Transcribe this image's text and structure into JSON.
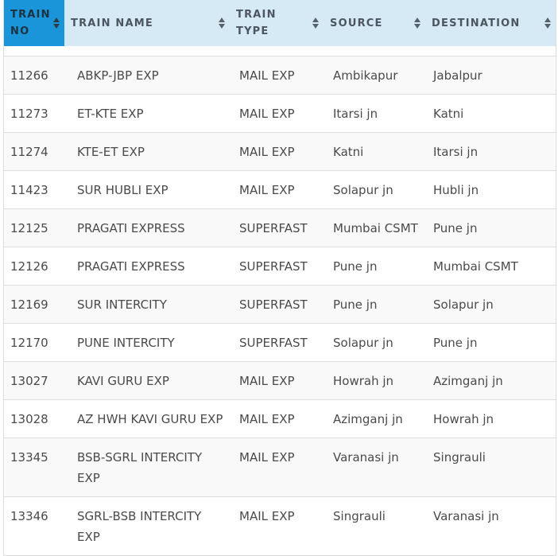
{
  "header": {
    "train_no": "TRAIN NO",
    "train_name": "TRAIN NAME",
    "train_type": "TRAIN TYPE",
    "source": "SOURCE",
    "destination": "DESTINATION"
  },
  "colors": {
    "header_bg": "#d6eaf5",
    "active_header_bg": "#1a95d9",
    "row_alt_bg": "#f9f9f9",
    "text": "#4a4a4a"
  },
  "rows": [
    {
      "no": "11266",
      "name": "ABKP-JBP EXP",
      "type": "MAIL EXP",
      "source": "Ambikapur",
      "destination": "Jabalpur"
    },
    {
      "no": "11273",
      "name": "ET-KTE EXP",
      "type": "MAIL EXP",
      "source": "Itarsi jn",
      "destination": "Katni"
    },
    {
      "no": "11274",
      "name": "KTE-ET EXP",
      "type": "MAIL EXP",
      "source": "Katni",
      "destination": "Itarsi jn"
    },
    {
      "no": "11423",
      "name": "SUR HUBLI EXP",
      "type": "MAIL EXP",
      "source": "Solapur jn",
      "destination": "Hubli jn"
    },
    {
      "no": "12125",
      "name": "PRAGATI EXPRESS",
      "type": "SUPERFAST",
      "source": "Mumbai CSMT",
      "destination": "Pune jn"
    },
    {
      "no": "12126",
      "name": "PRAGATI EXPRESS",
      "type": "SUPERFAST",
      "source": "Pune jn",
      "destination": "Mumbai CSMT"
    },
    {
      "no": "12169",
      "name": "SUR INTERCITY",
      "type": "SUPERFAST",
      "source": "Pune jn",
      "destination": "Solapur jn"
    },
    {
      "no": "12170",
      "name": "PUNE INTERCITY",
      "type": "SUPERFAST",
      "source": "Solapur jn",
      "destination": "Pune jn"
    },
    {
      "no": "13027",
      "name": "KAVI GURU EXP",
      "type": "MAIL EXP",
      "source": "Howrah jn",
      "destination": "Azimganj jn"
    },
    {
      "no": "13028",
      "name": "AZ HWH KAVI GURU EXP",
      "type": "MAIL EXP",
      "source": "Azimganj jn",
      "destination": "Howrah jn"
    },
    {
      "no": "13345",
      "name": "BSB-SGRL INTERCITY EXP",
      "type": "MAIL EXP",
      "source": "Varanasi jn",
      "destination": "Singrauli"
    },
    {
      "no": "13346",
      "name": "SGRL-BSB INTERCITY EXP",
      "type": "MAIL EXP",
      "source": "Singrauli",
      "destination": "Varanasi jn"
    }
  ]
}
